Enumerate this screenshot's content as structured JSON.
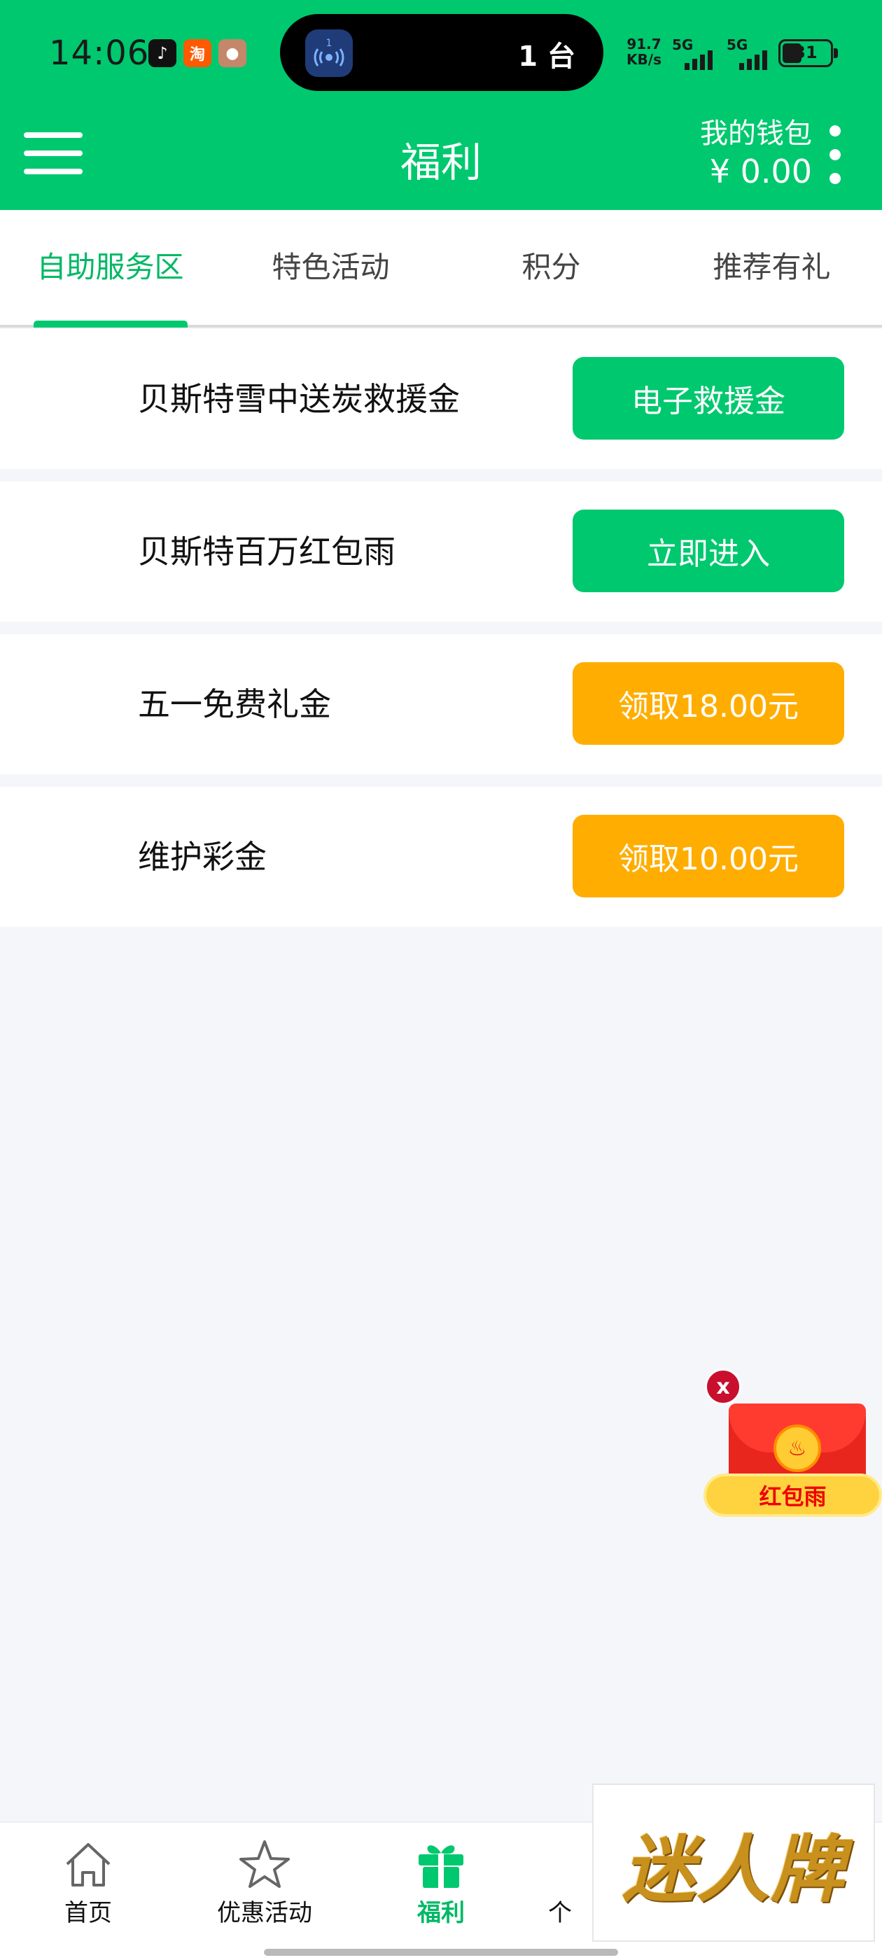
{
  "status_bar": {
    "time": "14:06",
    "island_count": "1 台",
    "island_badge": "1",
    "net_speed_value": "91.7",
    "net_speed_unit": "KB/s",
    "signal_1_label": "5G",
    "signal_2_label": "5G",
    "battery_level": "31",
    "app_icons": [
      "tiktok-icon",
      "taobao-icon",
      "pet-app-icon"
    ],
    "taobao_glyph": "淘"
  },
  "header": {
    "title": "福利",
    "wallet_label": "我的钱包",
    "wallet_amount": "¥ 0.00"
  },
  "tabs": [
    {
      "label": "自助服务区",
      "active": true
    },
    {
      "label": "特色活动",
      "active": false
    },
    {
      "label": "积分",
      "active": false
    },
    {
      "label": "推荐有礼",
      "active": false
    }
  ],
  "rows": [
    {
      "title": "贝斯特雪中送炭救援金",
      "button": "电子救援金",
      "button_color": "#00c86f"
    },
    {
      "title": "贝斯特百万红包雨",
      "button": "立即进入",
      "button_color": "#00c86f"
    },
    {
      "title": "五一免费礼金",
      "button": "领取18.00元",
      "button_color": "#ffad00"
    },
    {
      "title": "维护彩金",
      "button": "领取10.00元",
      "button_color": "#ffad00"
    }
  ],
  "red_packet": {
    "close_label": "x",
    "label": "红包雨"
  },
  "bottom_nav": [
    {
      "label": "首页",
      "icon": "home-icon"
    },
    {
      "label": "优惠活动",
      "icon": "star-icon"
    },
    {
      "label": "福利",
      "icon": "gift-icon",
      "active": true
    },
    {
      "label": "个",
      "icon": "person-icon"
    }
  ],
  "overlay": {
    "brand_text": "迷人牌"
  },
  "colors": {
    "primary_green": "#00c86f",
    "accent_orange": "#ffad00",
    "background": "#f5f6fa"
  }
}
